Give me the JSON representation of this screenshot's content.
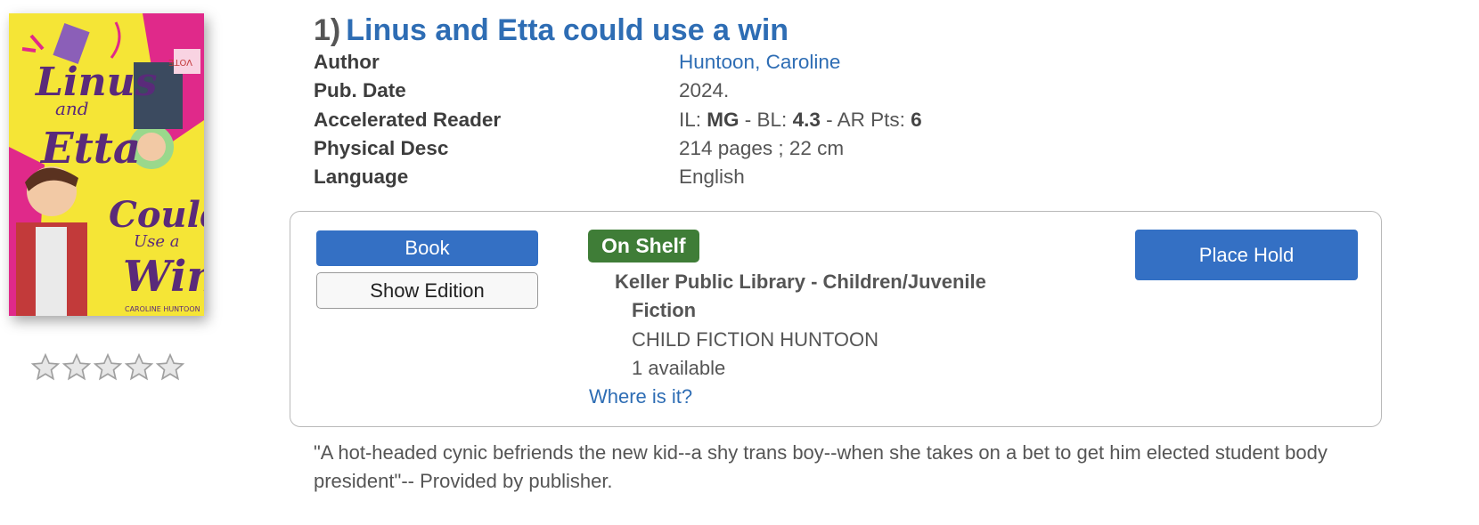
{
  "cover": {
    "title_lines": [
      "Linus",
      "and",
      "Etta",
      "Could",
      "Use a",
      "Win"
    ],
    "author": "CAROLINE HUNTOON",
    "sign_text": "VOTE",
    "colors": {
      "background": "#f5e536",
      "accent": "#e0298a",
      "title": "#5a2a7a"
    }
  },
  "rating": {
    "stars_filled": 0,
    "stars_total": 5
  },
  "result": {
    "number": "1)",
    "title": "Linus and Etta could use a win"
  },
  "fields": [
    {
      "label": "Author",
      "value": "Huntoon, Caroline",
      "is_link": true
    },
    {
      "label": "Pub. Date",
      "value": "2024."
    },
    {
      "label": "Accelerated Reader",
      "il_prefix": "IL: ",
      "il": "MG",
      "bl_prefix": " - BL: ",
      "bl": "4.3",
      "ar_prefix": " - AR Pts: ",
      "ar": "6"
    },
    {
      "label": "Physical Desc",
      "value": "214 pages ; 22 cm"
    },
    {
      "label": "Language",
      "value": "English"
    }
  ],
  "holdings": {
    "format_button": "Book",
    "edition_button": "Show Edition",
    "status": "On Shelf",
    "location_line1": "Keller Public Library - Children/Juvenile",
    "location_line2": "Fiction",
    "call_number": "CHILD FICTION HUNTOON",
    "availability": "1 available",
    "where_link": "Where is it?",
    "hold_button": "Place Hold"
  },
  "summary": "\"A hot-headed cynic befriends the new kid--a shy trans boy--when she takes on a bet to get him elected student body president\"-- Provided by publisher.",
  "colors": {
    "link": "#2e6db4",
    "button": "#3470c4",
    "status_green": "#3f7d37"
  }
}
